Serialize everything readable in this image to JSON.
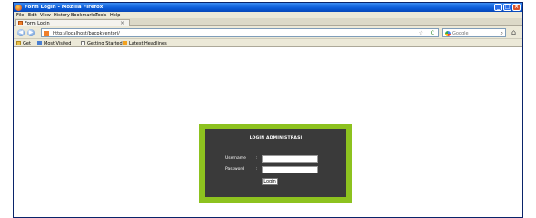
{
  "window": {
    "title": "Form Login - Mozilla Firefox",
    "controls": {
      "minimize": "_",
      "maximize": "□",
      "close": "×"
    }
  },
  "menubar": {
    "items": [
      "File",
      "Edit",
      "View",
      "History",
      "Bookmarks",
      "Tools",
      "Help"
    ]
  },
  "tabs": [
    {
      "label": "Form Login",
      "close": "×",
      "active": true
    }
  ],
  "navigation": {
    "back": "◀",
    "forward": "▶",
    "url": "http://localhost/bacpkventori/",
    "star": "☆",
    "reload": "C",
    "search_placeholder": "Google",
    "search_icon": "magnifier-icon",
    "home": "⌂"
  },
  "bookmarks": [
    {
      "label": "Get",
      "icon": "folder-icon"
    },
    {
      "label": "Most Visited",
      "icon": "most-visited-icon"
    },
    {
      "label": "Getting Started",
      "icon": "page-icon"
    },
    {
      "label": "Latest Headlines",
      "icon": "rss-icon"
    }
  ],
  "login": {
    "title": "LOGIN ADMINISTRASI",
    "username_label": "Username",
    "password_label": "Password",
    "separator": ":",
    "username_value": "",
    "password_value": "",
    "button_label": "Login"
  },
  "colors": {
    "frame_green": "#8dc21f",
    "panel_dark": "#3a3a3a"
  }
}
